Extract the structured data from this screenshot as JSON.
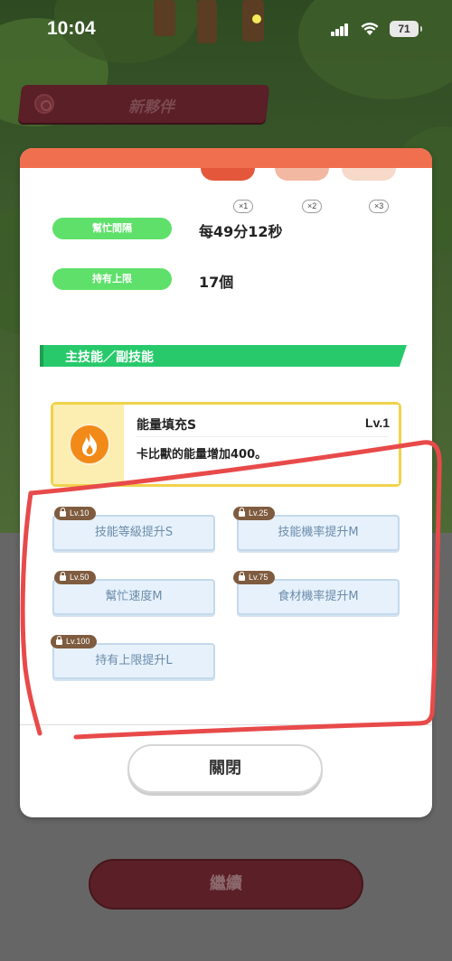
{
  "status_bar": {
    "time": "10:04",
    "battery": "71"
  },
  "header": {
    "title": "新夥伴"
  },
  "berries": [
    {
      "count": "×1",
      "color": "#e4573a"
    },
    {
      "count": "×2",
      "color": "#f2b8a2"
    },
    {
      "count": "×3",
      "color": "#f6d9c8"
    }
  ],
  "stats": [
    {
      "label": "幫忙間隔",
      "value": "每49分12秒"
    },
    {
      "label": "持有上限",
      "value": "17個"
    }
  ],
  "skills_section": {
    "title": "主技能／副技能"
  },
  "main_skill": {
    "name": "能量填充S",
    "level": "Lv.1",
    "description": "卡比獸的能量增加400。",
    "icon": "fire-icon",
    "icon_color": "#f28a1a"
  },
  "sub_skills": [
    {
      "unlock_level": "Lv.10",
      "name": "技能等級提升S"
    },
    {
      "unlock_level": "Lv.25",
      "name": "技能機率提升M"
    },
    {
      "unlock_level": "Lv.50",
      "name": "幫忙速度M"
    },
    {
      "unlock_level": "Lv.75",
      "name": "食材機率提升M"
    },
    {
      "unlock_level": "Lv.100",
      "name": "持有上限提升L"
    }
  ],
  "buttons": {
    "close": "關閉",
    "continue": "繼續"
  },
  "colors": {
    "modal_accent": "#f06f4f",
    "stat_pill": "#5fe06a",
    "section_header": "#27c96b",
    "annotation": "#e84a4a"
  }
}
